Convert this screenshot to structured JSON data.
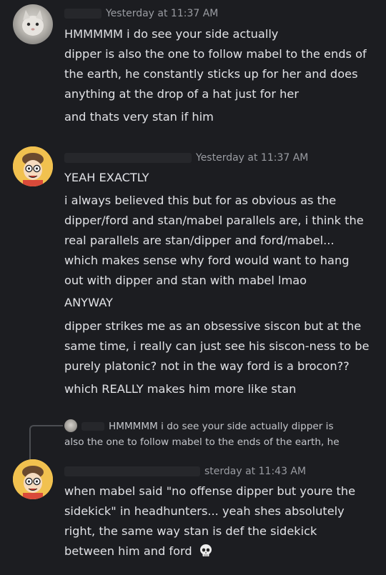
{
  "messages": [
    {
      "time": "Yesterday at 11:37 AM",
      "lines": [
        "HMMMMM i do see your side actually",
        "dipper is also the one to follow mabel to the ends of",
        "the earth, he constantly sticks up for her and does",
        "anything at the drop of a hat just for her",
        "and thats very stan if him"
      ]
    },
    {
      "time": "Yesterday at 11:37 AM",
      "lines": [
        "YEAH EXACTLY",
        "i always believed this but for as obvious as the",
        "dipper/ford and stan/mabel parallels are, i think the",
        "real parallels are stan/dipper and ford/mabel...",
        "which makes sense why ford would want to hang",
        "out with dipper and stan with mabel lmao",
        "ANYWAY",
        "dipper strikes me as an obsessive siscon but at the",
        "same time, i really can just see his siscon-ness to be",
        "purely platonic? not in the way ford is a brocon??",
        "which REALLY makes him more like stan"
      ]
    },
    {
      "reply_lines": [
        "HMMMMM i do see your side actually dipper is",
        "also the one to follow mabel to the ends of the earth, he"
      ],
      "time": "sterday at 11:43 AM",
      "lines": [
        "when mabel said \"no offense dipper but youre the",
        "sidekick\" in headhunters... yeah shes absolutely",
        "right, the same way stan is def the sidekick",
        "between him and ford"
      ]
    }
  ],
  "icons": {
    "avatar_1": "cat-avatar",
    "avatar_2": "cartoon-boy-avatar",
    "reply_avatar": "cat-mini-avatar",
    "emoji": "skull-emoji"
  },
  "colors": {
    "background": "#1c1d21",
    "timestamp": "#9a9ca2",
    "text": "#e1e2e6"
  }
}
